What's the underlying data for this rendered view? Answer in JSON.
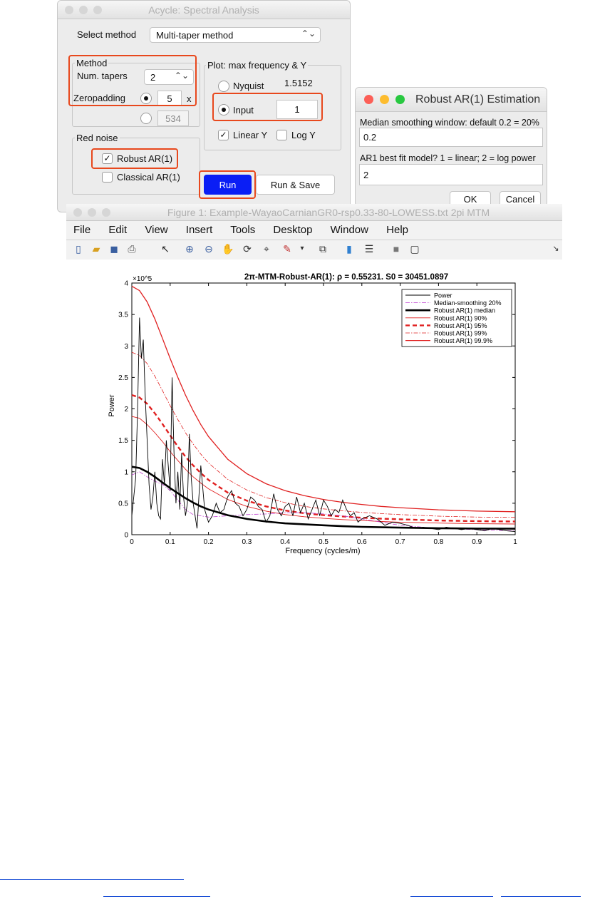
{
  "acycle": {
    "title": "Acycle: Spectral Analysis",
    "select_method_label": "Select method",
    "method_value": "Multi-taper method",
    "method_group": "Method",
    "num_tapers_label": "Num. tapers",
    "num_tapers_value": "2",
    "zeropadding_label": "Zeropadding",
    "zeropadding_value": "5",
    "zeropadding_unit": "x",
    "zeropadding_alt_value": "534",
    "red_noise_group": "Red noise",
    "robust_ar1_label": "Robust AR(1)",
    "classical_ar1_label": "Classical AR(1)",
    "plot_group": "Plot: max frequency & Y",
    "nyquist_label": "Nyquist",
    "nyquist_value": "1.5152",
    "input_label": "Input",
    "input_value": "1",
    "linear_y_label": "Linear Y",
    "log_y_label": "Log Y",
    "run_label": "Run",
    "run_save_label": "Run & Save",
    "colors": {
      "run": "#0a1ef5",
      "highlight": "#e8481d"
    }
  },
  "robust_dialog": {
    "title": "Robust AR(1) Estimation",
    "prompt1": "Median smoothing window: default 0.2 = 20%",
    "value1": "0.2",
    "prompt2": "AR1 best fit model? 1 = linear; 2 = log power",
    "value2": "2",
    "ok_label": "OK",
    "cancel_label": "Cancel"
  },
  "figure": {
    "title": "Figure 1: Example-WayaoCarnianGR0-rsp0.33-80-LOWESS.txt 2pi MTM",
    "menu": [
      "File",
      "Edit",
      "View",
      "Insert",
      "Tools",
      "Desktop",
      "Window",
      "Help"
    ],
    "toolbar_icons": [
      "new-file-icon",
      "open-folder-icon",
      "save-icon",
      "print-icon",
      "pointer-icon",
      "zoom-in-icon",
      "zoom-out-icon",
      "pan-icon",
      "rotate-3d-icon",
      "data-cursor-icon",
      "brush-icon",
      "dropdown-arrow-icon",
      "link-plot-icon",
      "colorbar-icon",
      "legend-icon",
      "hide-tools-icon",
      "dock-icon"
    ],
    "dock_arrow": "↘"
  },
  "chart_data": {
    "type": "line",
    "title": "2π-MTM-Robust-AR(1): ρ = 0.55231. S0 = 30451.0897",
    "xlabel": "Frequency (cycles/m)",
    "ylabel": "Power",
    "y_exponent": "×10^5",
    "xlim": [
      0,
      1
    ],
    "ylim": [
      0,
      400000
    ],
    "xticks": [
      "0",
      "0.1",
      "0.2",
      "0.3",
      "0.4",
      "0.5",
      "0.6",
      "0.7",
      "0.8",
      "0.9",
      "1"
    ],
    "yticks": [
      "0",
      "0.5",
      "1",
      "1.5",
      "2",
      "2.5",
      "3",
      "3.5",
      "4"
    ],
    "legend_position": "top-right",
    "series": [
      {
        "name": "Power",
        "color": "#000000",
        "style": "solid-thin",
        "x": [
          0,
          0.005,
          0.01,
          0.015,
          0.02,
          0.025,
          0.03,
          0.035,
          0.04,
          0.045,
          0.05,
          0.055,
          0.06,
          0.065,
          0.07,
          0.075,
          0.08,
          0.085,
          0.09,
          0.095,
          0.1,
          0.105,
          0.11,
          0.115,
          0.12,
          0.125,
          0.13,
          0.135,
          0.14,
          0.145,
          0.15,
          0.155,
          0.16,
          0.165,
          0.17,
          0.175,
          0.18,
          0.19,
          0.2,
          0.21,
          0.22,
          0.23,
          0.24,
          0.25,
          0.26,
          0.27,
          0.28,
          0.29,
          0.3,
          0.31,
          0.32,
          0.33,
          0.34,
          0.35,
          0.36,
          0.37,
          0.38,
          0.39,
          0.4,
          0.41,
          0.42,
          0.43,
          0.44,
          0.45,
          0.46,
          0.47,
          0.48,
          0.49,
          0.5,
          0.51,
          0.52,
          0.53,
          0.54,
          0.55,
          0.56,
          0.57,
          0.58,
          0.59,
          0.6,
          0.62,
          0.64,
          0.66,
          0.68,
          0.7,
          0.72,
          0.74,
          0.76,
          0.78,
          0.8,
          0.82,
          0.84,
          0.86,
          0.88,
          0.9,
          0.92,
          0.94,
          0.96,
          0.98,
          1.0
        ],
        "y": [
          30000,
          60000,
          90000,
          200000,
          345000,
          280000,
          310000,
          220000,
          150000,
          80000,
          40000,
          60000,
          100000,
          50000,
          30000,
          25000,
          120000,
          80000,
          150000,
          110000,
          70000,
          250000,
          130000,
          50000,
          100000,
          40000,
          130000,
          60000,
          30000,
          50000,
          160000,
          90000,
          50000,
          30000,
          10000,
          60000,
          110000,
          40000,
          20000,
          30000,
          50000,
          35000,
          40000,
          60000,
          70000,
          50000,
          45000,
          30000,
          40000,
          60000,
          55000,
          45000,
          40000,
          20000,
          30000,
          65000,
          40000,
          30000,
          45000,
          50000,
          30000,
          60000,
          35000,
          50000,
          25000,
          40000,
          55000,
          30000,
          55000,
          45000,
          30000,
          40000,
          35000,
          55000,
          40000,
          30000,
          35000,
          20000,
          25000,
          30000,
          25000,
          15000,
          20000,
          18000,
          15000,
          10000,
          12000,
          10000,
          8000,
          12000,
          10000,
          8000,
          10000,
          8000,
          6000,
          10000,
          8000,
          6000,
          5000
        ]
      },
      {
        "name": "Median-smoothing 20%",
        "color": "#c040d0",
        "style": "dashdot-thin",
        "x": [
          0,
          0.02,
          0.04,
          0.06,
          0.08,
          0.1,
          0.12,
          0.14,
          0.16,
          0.2,
          0.25,
          0.3,
          0.35,
          0.4,
          0.45,
          0.5,
          0.55,
          0.6,
          0.7,
          0.8,
          0.9,
          1.0
        ],
        "y": [
          95000,
          100000,
          92000,
          85000,
          80000,
          70000,
          55000,
          40000,
          32000,
          28000,
          30000,
          32000,
          33000,
          35000,
          35000,
          33000,
          30000,
          25000,
          15000,
          10000,
          8000,
          6000
        ]
      },
      {
        "name": "Robust AR(1) median",
        "color": "#000000",
        "style": "solid-thick",
        "x": [
          0,
          0.02,
          0.04,
          0.06,
          0.08,
          0.1,
          0.12,
          0.14,
          0.16,
          0.18,
          0.2,
          0.25,
          0.3,
          0.35,
          0.4,
          0.45,
          0.5,
          0.55,
          0.6,
          0.65,
          0.7,
          0.8,
          0.9,
          1.0
        ],
        "y": [
          108000,
          106000,
          100000,
          92000,
          83000,
          74000,
          66000,
          58000,
          51000,
          45000,
          40000,
          31000,
          25000,
          21000,
          18000,
          16500,
          15000,
          13500,
          12500,
          11800,
          11200,
          10300,
          9800,
          9500
        ]
      },
      {
        "name": "Robust AR(1) 90%",
        "color": "#e02020",
        "style": "solid-thin",
        "x": [
          0,
          0.02,
          0.04,
          0.06,
          0.08,
          0.1,
          0.12,
          0.14,
          0.16,
          0.18,
          0.2,
          0.25,
          0.3,
          0.35,
          0.4,
          0.45,
          0.5,
          0.55,
          0.6,
          0.65,
          0.7,
          0.8,
          0.9,
          1.0
        ],
        "y": [
          188000,
          185000,
          175000,
          162000,
          148000,
          132000,
          118000,
          104000,
          92000,
          82000,
          73000,
          56000,
          45000,
          37500,
          32000,
          28500,
          26000,
          24000,
          22500,
          21000,
          20000,
          18500,
          17500,
          17000
        ]
      },
      {
        "name": "Robust AR(1) 95%",
        "color": "#e02020",
        "style": "dashed-thick",
        "x": [
          0,
          0.02,
          0.04,
          0.06,
          0.08,
          0.1,
          0.12,
          0.14,
          0.16,
          0.18,
          0.2,
          0.25,
          0.3,
          0.35,
          0.4,
          0.45,
          0.5,
          0.55,
          0.6,
          0.65,
          0.7,
          0.8,
          0.9,
          1.0
        ],
        "y": [
          222000,
          218000,
          208000,
          193000,
          176000,
          158000,
          140000,
          124000,
          110000,
          98000,
          87000,
          67000,
          54000,
          45000,
          38500,
          34000,
          31000,
          29000,
          27000,
          25500,
          24500,
          22500,
          21500,
          21000
        ]
      },
      {
        "name": "Robust AR(1) 99%",
        "color": "#e02020",
        "style": "dashdot-thin",
        "x": [
          0,
          0.02,
          0.04,
          0.06,
          0.08,
          0.1,
          0.12,
          0.14,
          0.16,
          0.18,
          0.2,
          0.25,
          0.3,
          0.35,
          0.4,
          0.45,
          0.5,
          0.55,
          0.6,
          0.65,
          0.7,
          0.8,
          0.9,
          1.0
        ],
        "y": [
          290000,
          285000,
          272000,
          252000,
          229000,
          205000,
          183000,
          162000,
          144000,
          128000,
          114000,
          88000,
          71000,
          59000,
          51000,
          45000,
          41000,
          38000,
          35500,
          33500,
          32000,
          29500,
          28000,
          27500
        ]
      },
      {
        "name": "Robust AR(1) 99.9%",
        "color": "#e02020",
        "style": "solid-medium",
        "x": [
          0,
          0.02,
          0.04,
          0.06,
          0.08,
          0.1,
          0.12,
          0.14,
          0.16,
          0.18,
          0.2,
          0.25,
          0.3,
          0.35,
          0.4,
          0.45,
          0.5,
          0.55,
          0.6,
          0.65,
          0.7,
          0.8,
          0.9,
          1.0
        ],
        "y": [
          395000,
          388000,
          370000,
          343000,
          312000,
          280000,
          250000,
          222000,
          197000,
          175000,
          156000,
          120000,
          97000,
          81000,
          70000,
          62000,
          56000,
          51500,
          48000,
          45000,
          43000,
          39500,
          37500,
          36500
        ]
      }
    ]
  }
}
